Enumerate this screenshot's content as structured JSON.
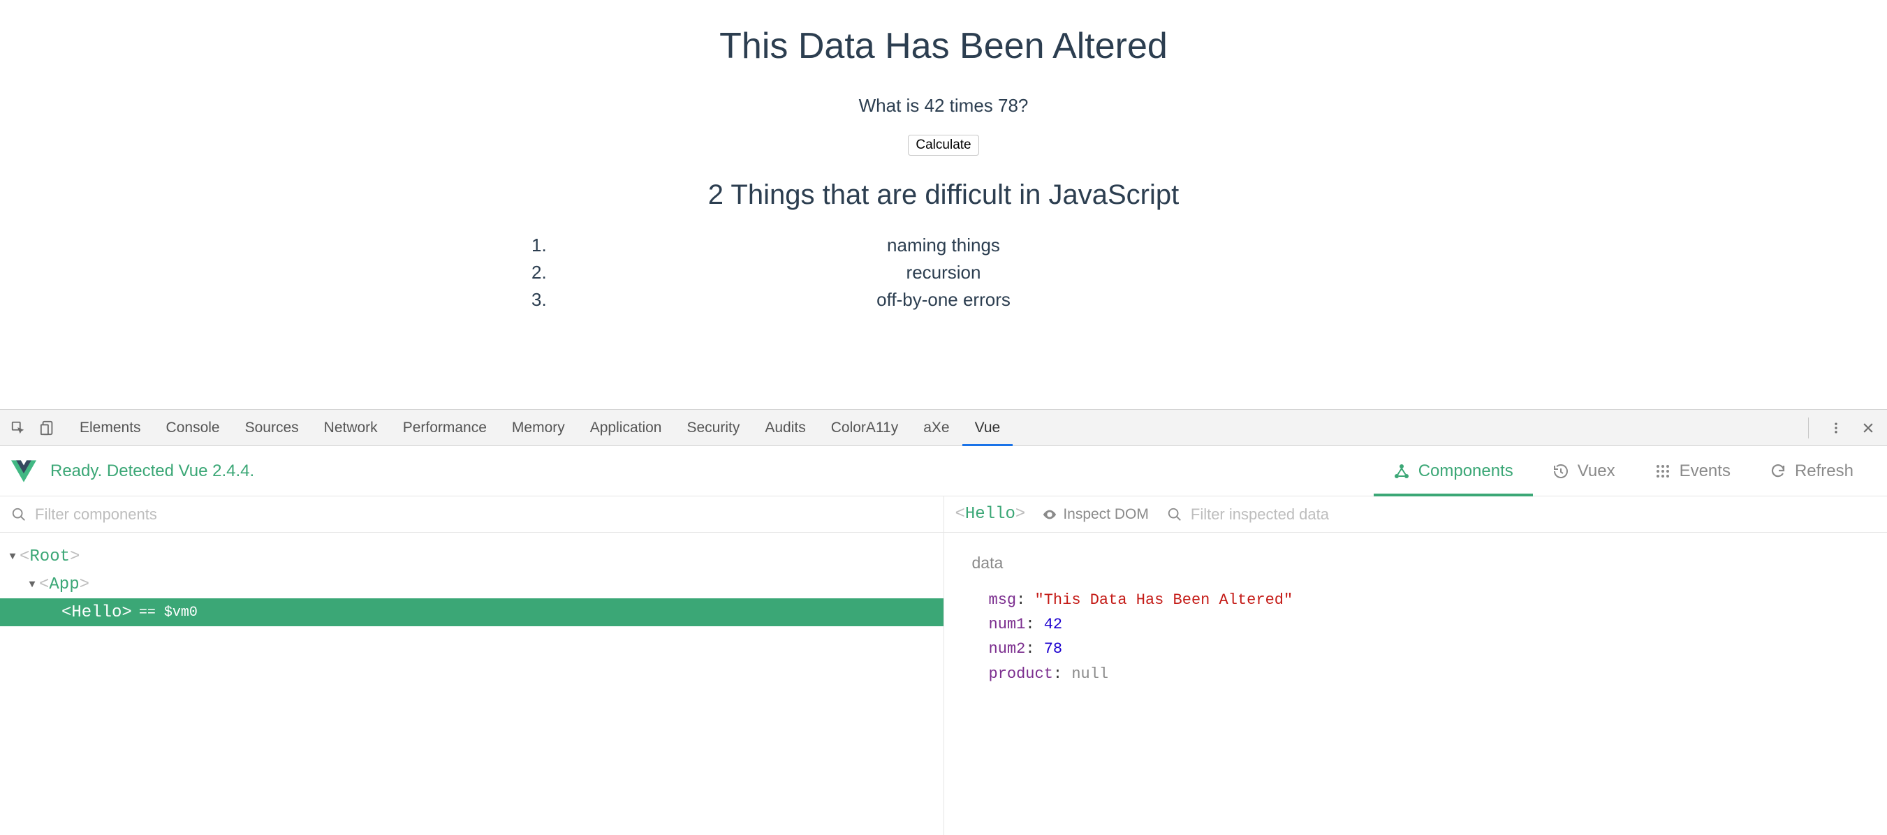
{
  "page": {
    "heading": "This Data Has Been Altered",
    "question": "What is 42 times 78?",
    "calc_label": "Calculate",
    "subheading": "2 Things that are difficult in JavaScript",
    "list": [
      "naming things",
      "recursion",
      "off-by-one errors"
    ]
  },
  "devtools_tabs": {
    "elements": "Elements",
    "console": "Console",
    "sources": "Sources",
    "network": "Network",
    "performance": "Performance",
    "memory": "Memory",
    "application": "Application",
    "security": "Security",
    "audits": "Audits",
    "colora11y": "ColorA11y",
    "axe": "aXe",
    "vue": "Vue"
  },
  "vue_header": {
    "status": "Ready. Detected Vue 2.4.4.",
    "tabs": {
      "components": "Components",
      "vuex": "Vuex",
      "events": "Events",
      "refresh": "Refresh"
    }
  },
  "left_panel": {
    "filter_placeholder": "Filter components",
    "tree": {
      "root": "Root",
      "app": "App",
      "hello": "Hello",
      "vm_badge": "== $vm0"
    }
  },
  "right_panel": {
    "selected": "Hello",
    "inspect_dom": "Inspect DOM",
    "filter_placeholder": "Filter inspected data",
    "data_heading": "data",
    "entries": {
      "msg": {
        "key": "msg",
        "value": "\"This Data Has Been Altered\"",
        "type": "str"
      },
      "num1": {
        "key": "num1",
        "value": "42",
        "type": "num"
      },
      "num2": {
        "key": "num2",
        "value": "78",
        "type": "num"
      },
      "product": {
        "key": "product",
        "value": "null",
        "type": "null"
      }
    }
  }
}
